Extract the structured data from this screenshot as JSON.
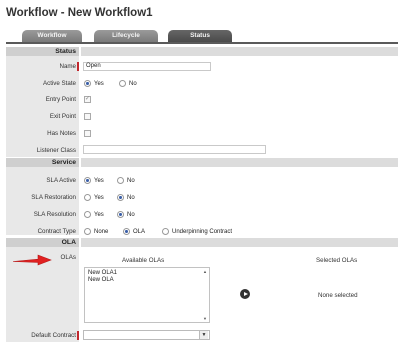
{
  "page_title": "Workflow - New Workflow1",
  "tabs": [
    {
      "label": "Workflow"
    },
    {
      "label": "Lifecycle"
    },
    {
      "label": "Status"
    }
  ],
  "sections": {
    "status": "Status",
    "service": "Service",
    "ola": "OLA"
  },
  "status_fields": {
    "name_label": "Name",
    "name_value": "Open",
    "active_state_label": "Active State",
    "active_state_options": [
      "Yes",
      "No"
    ],
    "active_state_selected": "Yes",
    "entry_point_label": "Entry Point",
    "entry_point_checked": true,
    "exit_point_label": "Exit Point",
    "exit_point_checked": false,
    "has_notes_label": "Has Notes",
    "has_notes_checked": false,
    "listener_class_label": "Listener Class",
    "listener_class_value": ""
  },
  "service_fields": {
    "sla_active_label": "SLA Active",
    "sla_active_options": [
      "Yes",
      "No"
    ],
    "sla_active_selected": "Yes",
    "sla_restoration_label": "SLA Restoration",
    "sla_restoration_options": [
      "Yes",
      "No"
    ],
    "sla_restoration_selected": "No",
    "sla_resolution_label": "SLA Resolution",
    "sla_resolution_options": [
      "Yes",
      "No"
    ],
    "sla_resolution_selected": "No",
    "contract_type_label": "Contract Type",
    "contract_type_options": [
      "None",
      "OLA",
      "Underpinning Contract"
    ],
    "contract_type_selected": "OLA"
  },
  "ola_fields": {
    "olas_label": "OLAs",
    "available_heading": "Available OLAs",
    "available_items": [
      "New OLA1",
      "New OLA"
    ],
    "selected_heading": "Selected OLAs",
    "selected_placeholder": "None selected",
    "default_contract_label": "Default Contract",
    "default_contract_value": ""
  },
  "colors": {
    "required_marker": "#c1272d",
    "annotation_arrow": "#e02020",
    "radio_selected": "#3b5fa8"
  },
  "icons": {
    "move_right": "move-right-icon",
    "annotation": "red-arrow-icon",
    "dropdown": "chevron-down-icon"
  }
}
